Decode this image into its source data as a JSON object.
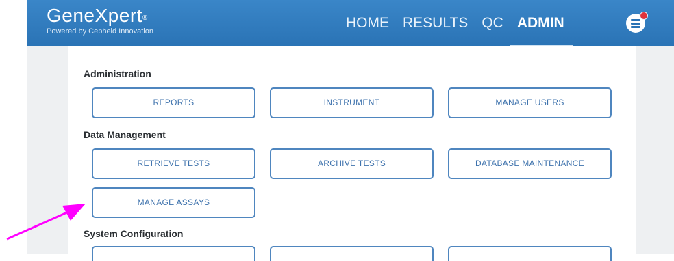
{
  "header": {
    "brand": "GeneXpert",
    "brand_mark": "®",
    "tagline": "Powered by Cepheid Innovation",
    "nav": [
      {
        "label": "HOME"
      },
      {
        "label": "RESULTS"
      },
      {
        "label": "QC"
      },
      {
        "label": "ADMIN",
        "active": true
      }
    ]
  },
  "sections": {
    "administration": {
      "title": "Administration",
      "buttons": [
        "REPORTS",
        "INSTRUMENT",
        "MANAGE USERS"
      ]
    },
    "data_management": {
      "title": "Data Management",
      "buttons": [
        "RETRIEVE TESTS",
        "ARCHIVE TESTS",
        "DATABASE MAINTENANCE",
        "MANAGE ASSAYS"
      ]
    },
    "system_configuration": {
      "title": "System Configuration"
    }
  },
  "colors": {
    "header_blue": "#2a73b5",
    "button_border": "#4f86bf",
    "button_text": "#3f73ad",
    "notification": "#e0323c",
    "annotation_arrow": "#ff00ff"
  },
  "icons": {
    "menu": "hamburger-menu-icon",
    "notification": "notification-dot-icon",
    "annotation": "pointer-arrow-icon"
  }
}
